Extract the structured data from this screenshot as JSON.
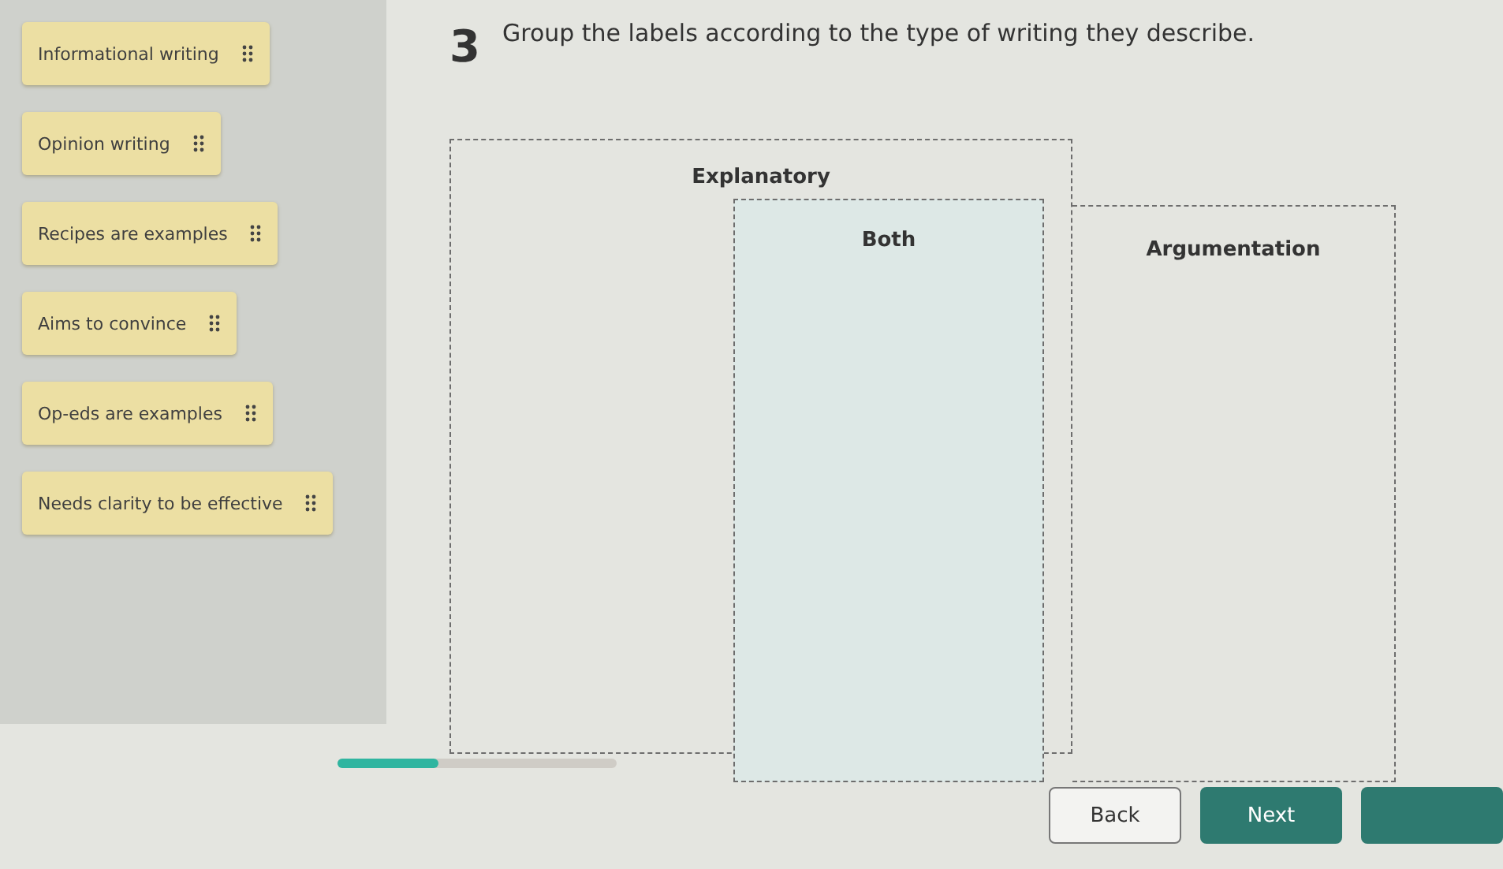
{
  "labels": [
    {
      "text": "Informational writing"
    },
    {
      "text": "Opinion writing"
    },
    {
      "text": "Recipes are examples"
    },
    {
      "text": "Aims to convince"
    },
    {
      "text": "Op-eds are examples"
    },
    {
      "text": "Needs clarity to be effective"
    }
  ],
  "question": {
    "number": "3",
    "prompt": "Group the labels according to the type of writing they describe."
  },
  "zones": [
    {
      "kind": "left",
      "title": "Explanatory"
    },
    {
      "kind": "right",
      "title": "Argumentation"
    },
    {
      "kind": "middle",
      "title": "Both"
    }
  ],
  "progress": {
    "level": 0.36
  },
  "buttons": [
    {
      "kind": "secondary",
      "label": "Back"
    },
    {
      "kind": "primary",
      "label": "Next"
    },
    {
      "kind": "primary"
    }
  ]
}
